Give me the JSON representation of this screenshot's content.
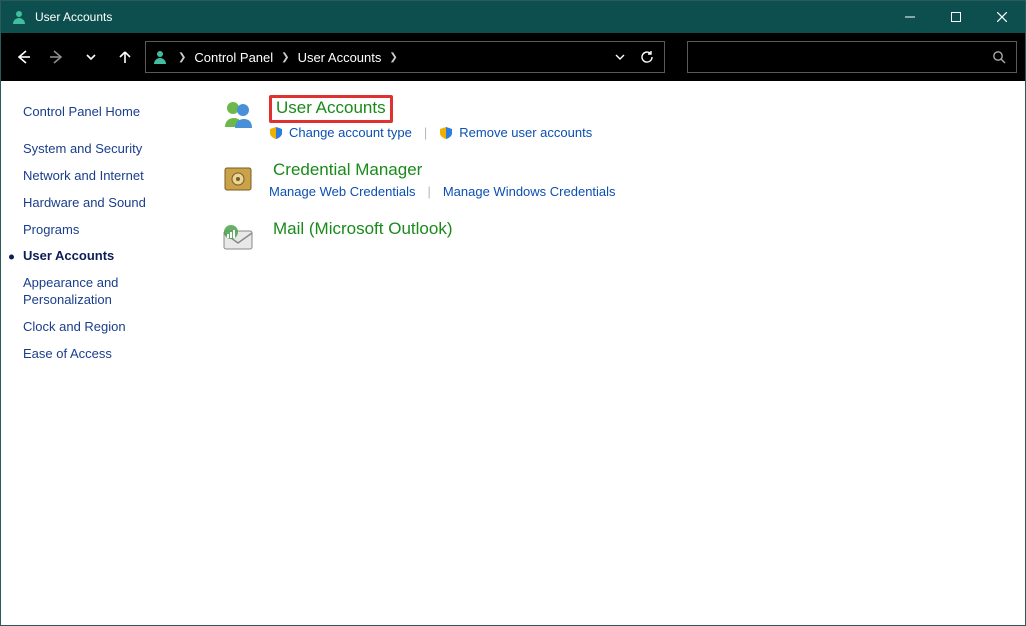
{
  "window": {
    "title": "User Accounts"
  },
  "breadcrumb": {
    "root": "Control Panel",
    "current": "User Accounts"
  },
  "sidebar": {
    "home": "Control Panel Home",
    "items": [
      "System and Security",
      "Network and Internet",
      "Hardware and Sound",
      "Programs",
      "User Accounts",
      "Appearance and Personalization",
      "Clock and Region",
      "Ease of Access"
    ],
    "active_index": 4
  },
  "categories": [
    {
      "title": "User Accounts",
      "highlighted": true,
      "icon": "people",
      "links": [
        {
          "label": "Change account type",
          "shield": true
        },
        {
          "label": "Remove user accounts",
          "shield": true
        }
      ]
    },
    {
      "title": "Credential Manager",
      "highlighted": false,
      "icon": "vault",
      "links": [
        {
          "label": "Manage Web Credentials",
          "shield": false
        },
        {
          "label": "Manage Windows Credentials",
          "shield": false
        }
      ]
    },
    {
      "title": "Mail (Microsoft Outlook)",
      "highlighted": false,
      "icon": "mail",
      "links": []
    }
  ]
}
